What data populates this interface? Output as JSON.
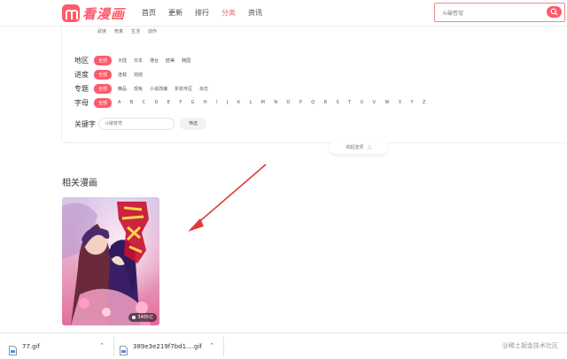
{
  "header": {
    "logo_text": "看漫画",
    "nav": [
      {
        "label": "首页",
        "active": false
      },
      {
        "label": "更新",
        "active": false
      },
      {
        "label": "排行",
        "active": false
      },
      {
        "label": "分类",
        "active": true
      },
      {
        "label": "资讯",
        "active": false
      }
    ],
    "search_placeholder": "斗破苍穹"
  },
  "filters": {
    "top_tags": [
      "武侠",
      "修真",
      "生活",
      "动作"
    ],
    "rows": [
      {
        "label": "地区",
        "selected": "全部",
        "options": [
          "大陆",
          "日本",
          "港台",
          "欧美",
          "韩国"
        ]
      },
      {
        "label": "进度",
        "selected": "全部",
        "options": [
          "连载",
          "完结"
        ]
      },
      {
        "label": "专题",
        "selected": "全部",
        "options": [
          "精品",
          "现免",
          "小说改编",
          "折扣专区",
          "杂志"
        ]
      },
      {
        "label": "字母",
        "selected": "全部",
        "options": [
          "A",
          "B",
          "C",
          "D",
          "E",
          "F",
          "G",
          "H",
          "I",
          "J",
          "K",
          "L",
          "M",
          "N",
          "O",
          "P",
          "Q",
          "R",
          "S",
          "T",
          "U",
          "V",
          "W",
          "X",
          "Y",
          "Z"
        ]
      }
    ],
    "keyword_label": "关键字",
    "keyword_placeholder": "斗破苍穹",
    "filter_button": "筛选",
    "collapse_label": "收起选项"
  },
  "related": {
    "title": "相关漫画",
    "cover_badge": "3405亿"
  },
  "downloads": [
    {
      "name": "77.gif"
    },
    {
      "name": "389e3e219f7bd1....gif"
    }
  ],
  "watermark": "@稀土掘金技术社区",
  "colors": {
    "accent": "#ff5a6a",
    "arrow": "#e03a3a"
  }
}
